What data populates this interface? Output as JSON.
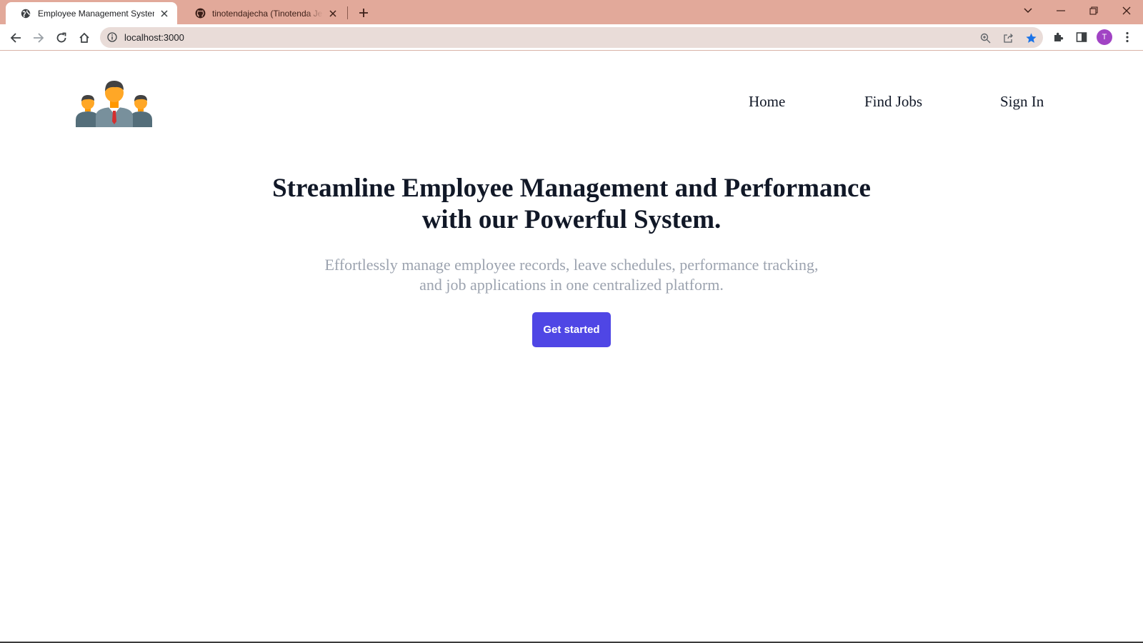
{
  "browser": {
    "tabs": [
      {
        "title": "Employee Management System",
        "active": true,
        "favicon": "globe-icon"
      },
      {
        "title": "tinotendajecha (Tinotenda Jecha)",
        "active": false,
        "favicon": "github-icon"
      }
    ],
    "address_bar": {
      "url": "localhost:3000"
    },
    "profile_initial": "T",
    "colors": {
      "tabstrip": "#e2a99a",
      "omnibox": "#e9dcd8",
      "bookmark_star": "#1a73e8",
      "avatar": "#a143c4"
    }
  },
  "header": {
    "logo": "team-people-icon",
    "nav": [
      {
        "label": "Home"
      },
      {
        "label": "Find Jobs"
      },
      {
        "label": "Sign In"
      }
    ]
  },
  "hero": {
    "title_line1": "Streamline Employee Management and Performance",
    "title_line2": "with our Powerful System.",
    "subtitle_line1": "Effortlessly manage employee records, leave schedules, performance tracking,",
    "subtitle_line2": "and job applications in one centralized platform.",
    "cta_label": "Get started",
    "cta_color": "#4f46e5"
  }
}
